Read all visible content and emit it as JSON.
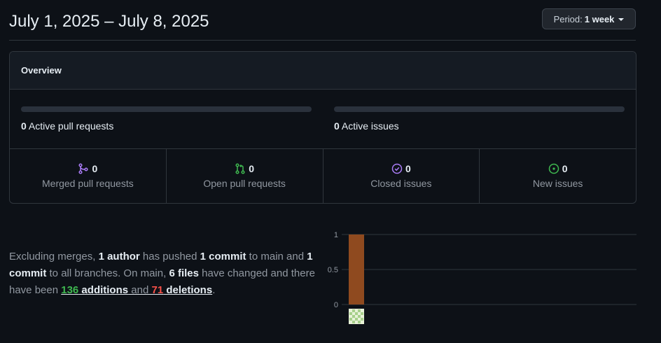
{
  "header": {
    "date_range": "July 1, 2025 – July 8, 2025",
    "period_label": "Period:",
    "period_value": "1 week"
  },
  "overview": {
    "title": "Overview",
    "active_prs": {
      "count": "0",
      "label": "Active pull requests"
    },
    "active_issues": {
      "count": "0",
      "label": "Active issues"
    },
    "stats": [
      {
        "count": "0",
        "label": "Merged pull requests",
        "icon": "merge-icon",
        "color": "#ab7df8"
      },
      {
        "count": "0",
        "label": "Open pull requests",
        "icon": "pull-request-icon",
        "color": "#3fb950"
      },
      {
        "count": "0",
        "label": "Closed issues",
        "icon": "issue-closed-icon",
        "color": "#ab7df8"
      },
      {
        "count": "0",
        "label": "New issues",
        "icon": "issue-opened-icon",
        "color": "#3fb950"
      }
    ]
  },
  "summary": {
    "t1": "Excluding merges, ",
    "authors": "1 author",
    "t2": " has pushed ",
    "commits_main": "1 commit",
    "t3": " to main and ",
    "commits_all": "1 commit",
    "t4": " to all branches. On main, ",
    "files": "6 files",
    "t5": " have changed and there have been ",
    "additions_num": "136",
    "additions_word": " additions",
    "t6": " and ",
    "deletions_num": "71",
    "deletions_word": " deletions",
    "t7": "."
  },
  "chart_data": {
    "type": "bar",
    "categories": [
      "author"
    ],
    "values": [
      1
    ],
    "ylim": [
      0,
      1
    ],
    "yticks": [
      "1",
      "0.5",
      "0"
    ],
    "bar_color": "#8f4a1f",
    "grid": true
  }
}
